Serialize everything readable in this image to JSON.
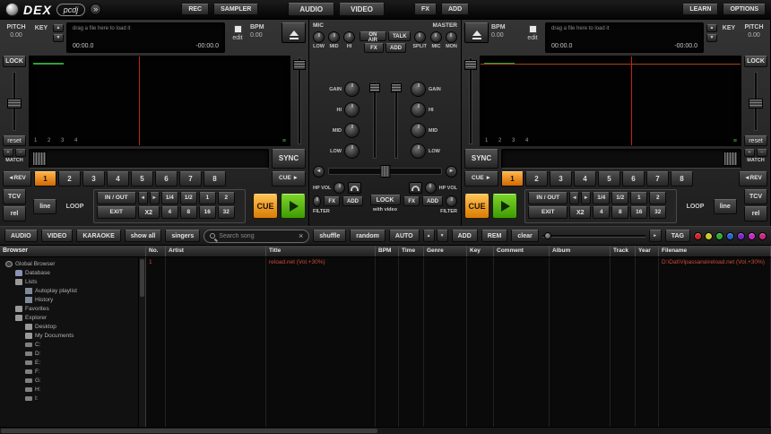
{
  "icons": {
    "arrow_up": "▲",
    "arrow_down": "▼",
    "arrow_left": "◄",
    "arrow_right": "►",
    "logo_arrow": "»",
    "clear_x": "×",
    "beat_grid": "≡"
  },
  "topbar": {
    "logo_text": "DEX",
    "logo_badge": "pcdj",
    "rec": "REC",
    "sampler": "SAMPLER",
    "audio": "AUDIO",
    "video": "VIDEO",
    "fx": "FX",
    "add": "ADD",
    "learn": "LEARN",
    "options": "OPTIONS"
  },
  "deck_left": {
    "pitch_label": "PITCH",
    "pitch_value": "0.00",
    "key_label": "KEY",
    "drop_hint": "drag a file here to load it",
    "time_elapsed": "00:00.0",
    "time_remaining": "-00:00.0",
    "edit_label": "edit",
    "bpm_label": "BPM",
    "bpm_value": "0.00",
    "lock_label": "LOCK",
    "reset_label": "reset",
    "beat_numbers": "1 2 3 4",
    "plus": "+",
    "minus": "−",
    "match_label": "MATCH",
    "sync_label": "SYNC",
    "rev_label": "◄REV",
    "cue_jump_label": "CUE ►",
    "hotcues": [
      {
        "label": "1",
        "cls": "active"
      },
      {
        "label": "2"
      },
      {
        "label": "3"
      },
      {
        "label": "4"
      },
      {
        "label": "5"
      },
      {
        "label": "6"
      },
      {
        "label": "7"
      },
      {
        "label": "8"
      }
    ],
    "tcv_label": "TCV",
    "rel_label": "rel",
    "line_label": "line",
    "loop_label": "LOOP",
    "in_out_label": "IN / OUT",
    "exit_label": "EXIT",
    "x2_label": "X2",
    "loop_lengths_small": [
      "1/4",
      "1/2",
      "1",
      "2"
    ],
    "loop_lengths_large": [
      "4",
      "8",
      "16",
      "32"
    ],
    "cue_label": "CUE"
  },
  "deck_right": {
    "pitch_label": "PITCH",
    "pitch_value": "0.00",
    "key_label": "KEY",
    "drop_hint": "drag a file here to load it",
    "time_elapsed": "00:00.0",
    "time_remaining": "-00:00.0",
    "edit_label": "edit",
    "bpm_label": "BPM",
    "bpm_value": "0.00",
    "lock_label": "LOCK",
    "reset_label": "reset",
    "beat_numbers": "1 2 3 4",
    "plus": "+",
    "minus": "−",
    "match_label": "MATCH",
    "sync_label": "SYNC",
    "rev_label": "◄REV",
    "cue_jump_label": "CUE ►",
    "hotcues": [
      {
        "label": "1",
        "cls": "active"
      },
      {
        "label": "2"
      },
      {
        "label": "3"
      },
      {
        "label": "4"
      },
      {
        "label": "5"
      },
      {
        "label": "6"
      },
      {
        "label": "7"
      },
      {
        "label": "8"
      }
    ],
    "tcv_label": "TCV",
    "rel_label": "rel",
    "line_label": "line",
    "loop_label": "LOOP",
    "in_out_label": "IN / OUT",
    "exit_label": "EXIT",
    "x2_label": "X2",
    "loop_lengths_small": [
      "1/4",
      "1/2",
      "1",
      "2"
    ],
    "loop_lengths_large": [
      "4",
      "8",
      "16",
      "32"
    ],
    "cue_label": "CUE"
  },
  "mixer": {
    "mic_label": "MIC",
    "mic_knobs": [
      {
        "label": "LOW"
      },
      {
        "label": "MID"
      },
      {
        "label": "HI"
      }
    ],
    "on_air_label": "ON AIR",
    "talk_label": "TALK",
    "mic_fx_label": "FX",
    "mic_add_label": "ADD",
    "master_label": "MASTER",
    "master_knobs": [
      {
        "label": "SPLIT"
      },
      {
        "label": "MIC"
      },
      {
        "label": "MON"
      }
    ],
    "eq_left": [
      {
        "label": "GAIN"
      },
      {
        "label": "HI"
      },
      {
        "label": "MID"
      },
      {
        "label": "LOW"
      }
    ],
    "eq_right": [
      {
        "label": "GAIN"
      },
      {
        "label": "HI"
      },
      {
        "label": "MID"
      },
      {
        "label": "LOW"
      }
    ],
    "hp_vol_label": "HP VOL",
    "filter_label": "FILTER",
    "fx_label": "FX",
    "add_label": "ADD",
    "lock_label": "LOCK",
    "with_video_label": "with video"
  },
  "browser_toolbar": {
    "audio": "AUDIO",
    "video": "VIDEO",
    "karaoke": "KARAOKE",
    "show_all": "show all",
    "singers": "singers",
    "search_placeholder": "Search song",
    "shuffle": "shuffle",
    "random": "random",
    "auto": "AUTO",
    "add": "ADD",
    "rem": "REM",
    "clear": "clear",
    "tag": "TAG",
    "tag_colors": [
      {
        "color": "#cc2626"
      },
      {
        "color": "#c9c926"
      },
      {
        "color": "#2eaa2e"
      },
      {
        "color": "#2662cc"
      },
      {
        "color": "#7a26cc"
      },
      {
        "color": "#c926c9"
      },
      {
        "color": "#cc2680"
      }
    ]
  },
  "browser": {
    "panel_header": "Browser",
    "tree": [
      {
        "label": "Global Browser",
        "depth": 0,
        "icon": "globe"
      },
      {
        "label": "Database",
        "depth": 1,
        "icon": "db"
      },
      {
        "label": "Lists",
        "depth": 1,
        "icon": "folder"
      },
      {
        "label": "Autoplay playlist",
        "depth": 2,
        "icon": "list"
      },
      {
        "label": "History",
        "depth": 2,
        "icon": "list"
      },
      {
        "label": "Favorites",
        "depth": 1,
        "icon": "folder"
      },
      {
        "label": "Explorer",
        "depth": 1,
        "icon": "folder"
      },
      {
        "label": "Desktop",
        "depth": 2,
        "icon": "folder"
      },
      {
        "label": "My Documents",
        "depth": 2,
        "icon": "folder"
      },
      {
        "label": "C:",
        "depth": 2,
        "icon": "drive"
      },
      {
        "label": "D:",
        "depth": 2,
        "icon": "drive"
      },
      {
        "label": "E:",
        "depth": 2,
        "icon": "drive"
      },
      {
        "label": "F:",
        "depth": 2,
        "icon": "drive"
      },
      {
        "label": "G:",
        "depth": 2,
        "icon": "drive"
      },
      {
        "label": "H:",
        "depth": 2,
        "icon": "drive"
      },
      {
        "label": "I:",
        "depth": 2,
        "icon": "drive"
      }
    ],
    "columns": [
      {
        "label": "No.",
        "cls": "col-no"
      },
      {
        "label": "Artist",
        "cls": "col-artist"
      },
      {
        "label": "Title",
        "cls": "col-title"
      },
      {
        "label": "BPM",
        "cls": "col-bpm"
      },
      {
        "label": "Time",
        "cls": "col-time"
      },
      {
        "label": "Genre",
        "cls": "col-genre"
      },
      {
        "label": "Key",
        "cls": "col-key"
      },
      {
        "label": "Comment",
        "cls": "col-comment"
      },
      {
        "label": "Album",
        "cls": "col-album"
      },
      {
        "label": "Track",
        "cls": "col-track"
      },
      {
        "label": "Year",
        "cls": "col-year"
      },
      {
        "label": "Filename",
        "cls": "col-filename"
      }
    ],
    "row": {
      "cells": [
        {
          "text": "1",
          "cls": "col-no"
        },
        {
          "text": "",
          "cls": "col-artist"
        },
        {
          "text": "reload.net (Vol.+30%)",
          "cls": "col-title"
        },
        {
          "text": "",
          "cls": "col-bpm"
        },
        {
          "text": "",
          "cls": "col-time"
        },
        {
          "text": "",
          "cls": "col-genre"
        },
        {
          "text": "",
          "cls": "col-key"
        },
        {
          "text": "",
          "cls": "col-comment"
        },
        {
          "text": "",
          "cls": "col-album"
        },
        {
          "text": "",
          "cls": "col-track"
        },
        {
          "text": "",
          "cls": "col-year"
        },
        {
          "text": "D:\\Dat\\Vipassana\\reload.net (Vol.+30%)",
          "cls": "col-filename"
        }
      ]
    }
  }
}
